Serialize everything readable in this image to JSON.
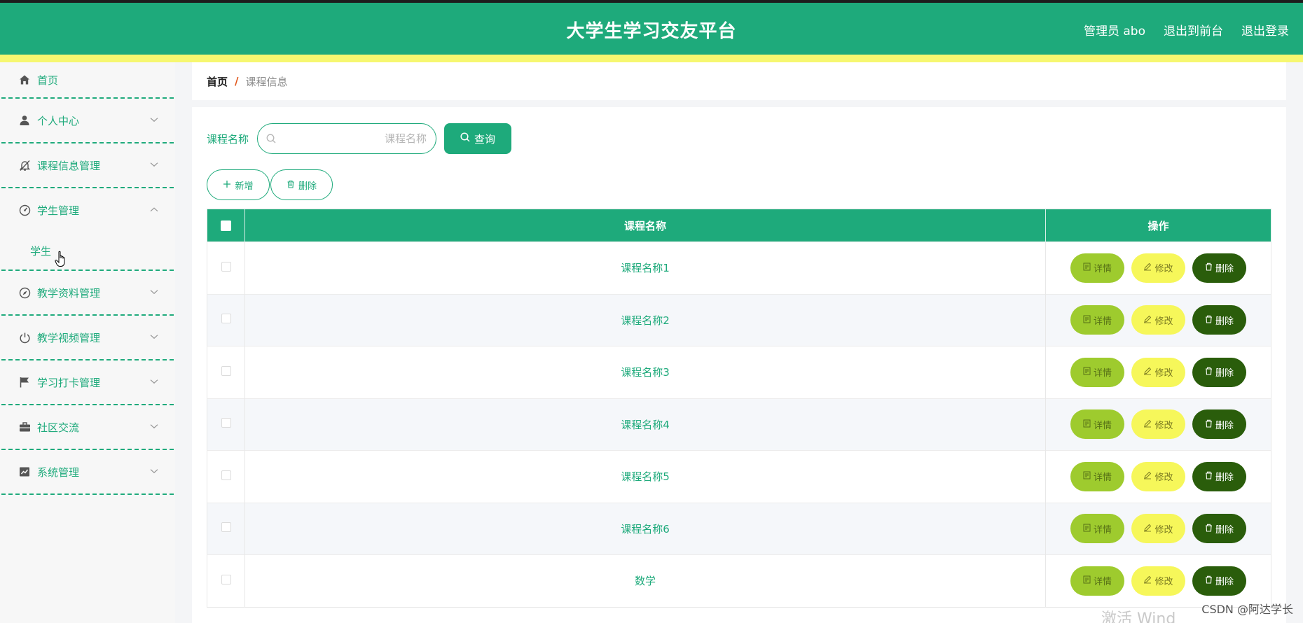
{
  "header": {
    "title": "大学生学习交友平台",
    "admin_label": "管理员 abo",
    "front_link": "退出到前台",
    "logout_link": "退出登录",
    "colors": {
      "primary": "#1eaa7b",
      "accent_bar": "#f6f770"
    }
  },
  "sidebar": {
    "items": [
      {
        "label": "首页",
        "icon": "home-icon"
      },
      {
        "label": "个人中心",
        "icon": "user-icon",
        "expanded": false
      },
      {
        "label": "课程信息管理",
        "icon": "bell-off-icon",
        "expanded": false
      },
      {
        "label": "学生管理",
        "icon": "gauge-icon",
        "expanded": true
      },
      {
        "label": "教学资料管理",
        "icon": "compass-icon",
        "expanded": false
      },
      {
        "label": "教学视频管理",
        "icon": "power-icon",
        "expanded": false
      },
      {
        "label": "学习打卡管理",
        "icon": "flag-icon",
        "expanded": false
      },
      {
        "label": "社区交流",
        "icon": "briefcase-icon",
        "expanded": false
      },
      {
        "label": "系统管理",
        "icon": "chart-icon",
        "expanded": false
      }
    ],
    "submenu": {
      "label": "学生"
    }
  },
  "breadcrumb": {
    "home": "首页",
    "separator": "/",
    "current": "课程信息"
  },
  "search": {
    "label": "课程名称",
    "placeholder": "课程名称",
    "value": "",
    "button": "查询"
  },
  "actions": {
    "add": "新增",
    "delete": "删除"
  },
  "table": {
    "columns": [
      "课程名称",
      "操作"
    ],
    "rows": [
      "课程名称1",
      "课程名称2",
      "课程名称3",
      "课程名称4",
      "课程名称5",
      "课程名称6",
      "数学"
    ],
    "buttons": {
      "detail": "详情",
      "edit": "修改",
      "delete": "删除"
    }
  },
  "watermark": {
    "text": "CSDN @阿达学长",
    "faint": "激活 Wind"
  }
}
